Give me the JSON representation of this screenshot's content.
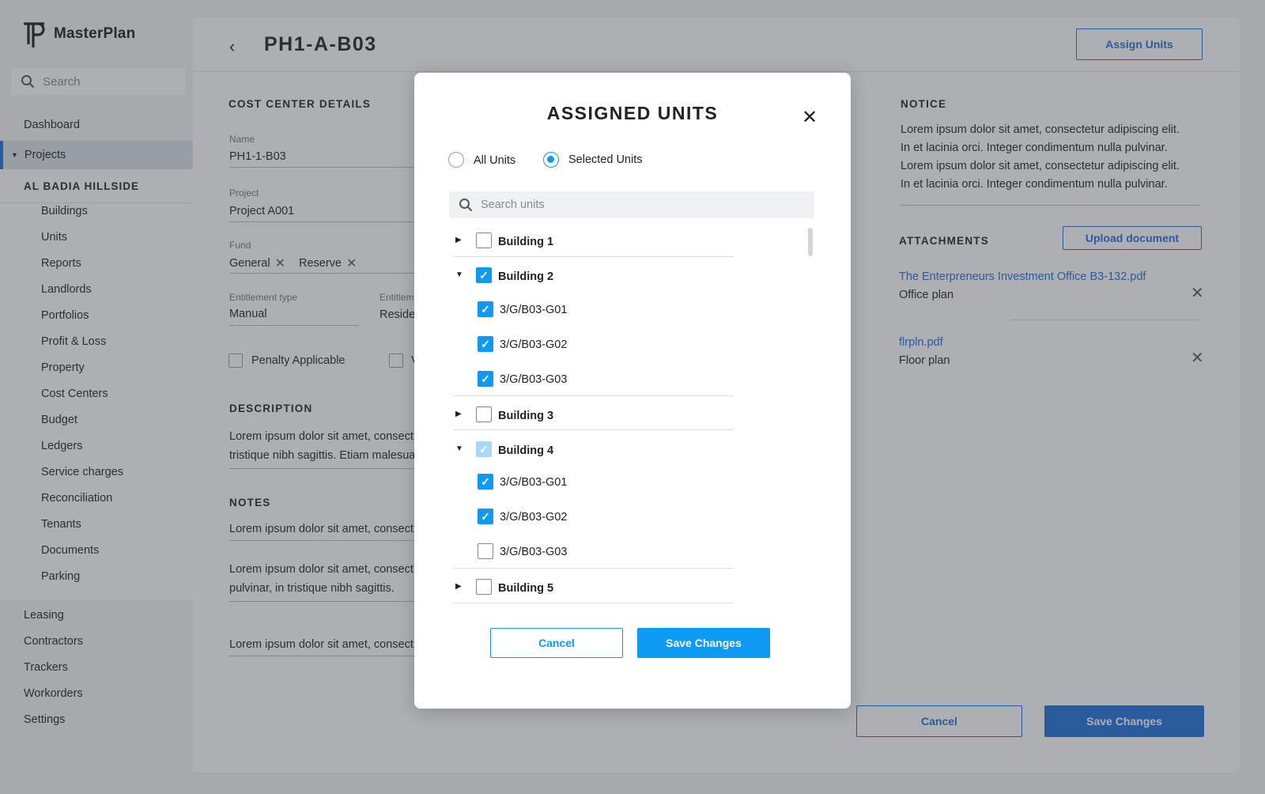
{
  "brand": {
    "name": "MasterPlan"
  },
  "sidebar": {
    "search_placeholder": "Search",
    "top_items": [
      "Dashboard",
      "Projects"
    ],
    "group_title": "AL BADIA HILLSIDE",
    "sub_items": [
      "Buildings",
      "Units",
      "Reports",
      "Landlords",
      "Portfolios",
      "Profit & Loss",
      "Property",
      "Cost Centers",
      "Budget",
      "Ledgers",
      "Service charges",
      "Reconciliation",
      "Tenants",
      "Documents",
      "Parking"
    ],
    "bottom_items": [
      "Leasing",
      "Contractors",
      "Trackers",
      "Workorders",
      "Settings"
    ]
  },
  "header": {
    "title": "PH1-A-B03",
    "assign_button": "Assign Units"
  },
  "cost_center": {
    "section_title": "COST CENTER DETAILS",
    "name_label": "Name",
    "name_value": "PH1-1-B03",
    "project_label": "Project",
    "project_value": "Project A001",
    "fund_label": "Fund",
    "fund_chips": [
      "General",
      "Reserve"
    ],
    "entitlement_type_label": "Entitlement type",
    "entitlement_type_value": "Manual",
    "entitlement_label_partial": "Entitlem",
    "entitlement_value_partial": "Reside",
    "penalty_label": "Penalty Applicable",
    "second_checkbox_partial": "V"
  },
  "description": {
    "title": "DESCRIPTION",
    "line1": "Lorem ipsum dolor sit amet, consect",
    "line2": "tristique nibh sagittis. Etiam malesua"
  },
  "notes": {
    "title": "NOTES",
    "note1": "Lorem ipsum dolor sit amet, consect",
    "note2_line1": "Lorem ipsum dolor sit amet, consect",
    "note2_line2": "pulvinar, in tristique nibh sagittis.",
    "note3": "Lorem ipsum dolor sit amet, consect"
  },
  "notice": {
    "title": "NOTICE",
    "lines": [
      "Lorem ipsum dolor sit amet, consectetur adipiscing elit.",
      "In et lacinia orci. Integer condimentum nulla pulvinar.",
      "Lorem ipsum dolor sit amet, consectetur adipiscing elit.",
      "In et lacinia orci. Integer condimentum nulla pulvinar."
    ]
  },
  "attachments": {
    "title": "ATTACHMENTS",
    "upload_button": "Upload document",
    "items": [
      {
        "file": "The Enterpreneurs Investment Office  B3-132.pdf",
        "desc": "Office plan"
      },
      {
        "file": "flrpln.pdf",
        "desc": "Floor plan"
      }
    ]
  },
  "footer": {
    "cancel": "Cancel",
    "save": "Save Changes"
  },
  "modal": {
    "title": "ASSIGNED UNITS",
    "radio_all": "All Units",
    "radio_selected": "Selected Units",
    "selected_mode": "selected",
    "search_placeholder": "Search units",
    "tree": [
      {
        "label": "Building 1",
        "expanded": false,
        "state": "unchecked"
      },
      {
        "label": "Building 2",
        "expanded": true,
        "state": "checked",
        "units": [
          {
            "label": "3/G/B03-G01",
            "checked": true
          },
          {
            "label": "3/G/B03-G02",
            "checked": true
          },
          {
            "label": "3/G/B03-G03",
            "checked": true
          }
        ]
      },
      {
        "label": "Building 3",
        "expanded": false,
        "state": "unchecked"
      },
      {
        "label": "Building 4",
        "expanded": true,
        "state": "partial",
        "units": [
          {
            "label": "3/G/B03-G01",
            "checked": true
          },
          {
            "label": "3/G/B03-G02",
            "checked": true
          },
          {
            "label": "3/G/B03-G03",
            "checked": false
          }
        ]
      },
      {
        "label": "Building 5",
        "expanded": false,
        "state": "unchecked"
      }
    ],
    "cancel": "Cancel",
    "save": "Save Changes"
  },
  "colors": {
    "primary": "#1e6fd9",
    "modal_accent": "#0d9af5"
  }
}
